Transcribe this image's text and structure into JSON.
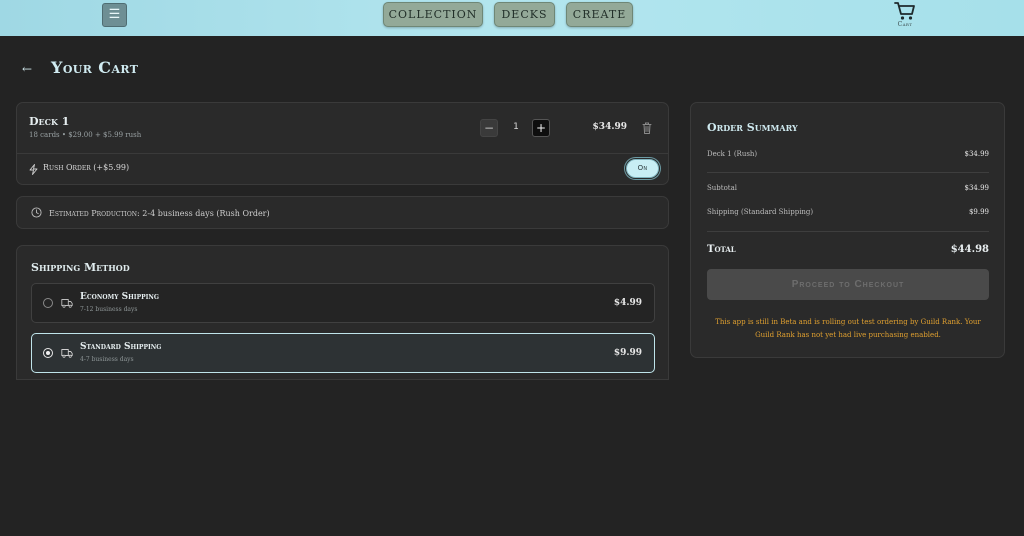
{
  "topbar": {
    "menu_icon": "☰",
    "nav": [
      {
        "label": "COLLECTION"
      },
      {
        "label": "DECKS"
      },
      {
        "label": "CREATE"
      }
    ],
    "cart_label": "Cart"
  },
  "page": {
    "back_icon": "←",
    "title": "Your Cart"
  },
  "cart_item": {
    "name": "Deck 1",
    "details": "18 cards • $29.00 + $5.99 rush",
    "quantity": "1",
    "minus_label": "−",
    "plus_label": "+",
    "price": "$34.99",
    "rush_label": "Rush Order (+$5.99)",
    "rush_toggle": "On"
  },
  "production": {
    "label": "Estimated Production:",
    "value": "2-4 business days (Rush Order)"
  },
  "shipping": {
    "title": "Shipping Method",
    "options": [
      {
        "name": "Economy Shipping",
        "days": "7-12 business days",
        "price": "$4.99",
        "selected": false
      },
      {
        "name": "Standard Shipping",
        "days": "4-7 business days",
        "price": "$9.99",
        "selected": true
      }
    ]
  },
  "summary": {
    "title": "Order Summary",
    "line_item": {
      "label": "Deck 1 (Rush)",
      "value": "$34.99"
    },
    "subtotal": {
      "label": "Subtotal",
      "value": "$34.99"
    },
    "shipping": {
      "label": "Shipping (Standard Shipping)",
      "value": "$9.99"
    },
    "total": {
      "label": "Total",
      "value": "$44.98"
    },
    "checkout_label": "Proceed to Checkout",
    "beta_note": "This app is still in Beta and is rolling out test ordering by Guild Rank. Your Guild Rank has not yet had live purchasing enabled."
  },
  "colors": {
    "topbar": "#a6e0ea",
    "background": "#232323",
    "card": "#2a2a2a",
    "accent": "#cfeaf0",
    "warning": "#e0a030"
  }
}
